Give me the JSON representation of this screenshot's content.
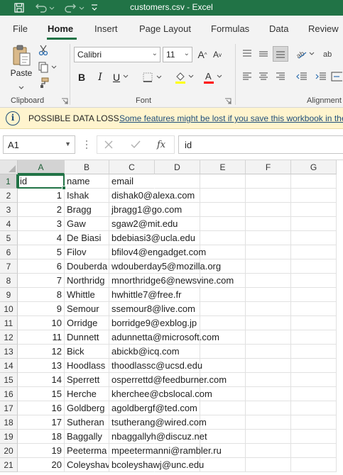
{
  "window": {
    "title": "customers.csv  -  Excel",
    "brand_color": "#217346",
    "quick_access": [
      "save-icon",
      "undo-icon",
      "redo-icon",
      "customize-icon"
    ]
  },
  "ribbon": {
    "tabs": [
      "File",
      "Home",
      "Insert",
      "Page Layout",
      "Formulas",
      "Data",
      "Review"
    ],
    "active_tab": "Home",
    "clipboard": {
      "paste_label": "Paste",
      "group_label": "Clipboard"
    },
    "font": {
      "family": "Calibri",
      "size": "11",
      "bold": "B",
      "italic": "I",
      "underline": "U",
      "group_label": "Font",
      "fill_color": "#ffff00",
      "font_color": "#ff0000"
    },
    "alignment": {
      "group_label": "Alignment"
    }
  },
  "message_bar": {
    "title": "POSSIBLE DATA LOSS",
    "text": "Some features might be lost if you save this workbook in the"
  },
  "formula_bar": {
    "name_box": "A1",
    "fx_label": "fx",
    "formula": "id"
  },
  "sheet": {
    "columns": [
      "A",
      "B",
      "C",
      "D",
      "E",
      "F",
      "G"
    ],
    "selected_column": "A",
    "selected_row": 1,
    "row_numbers": [
      1,
      2,
      3,
      4,
      5,
      6,
      7,
      8,
      9,
      10,
      11,
      12,
      13,
      14,
      15,
      16,
      17,
      18,
      19,
      20,
      21
    ],
    "headers": [
      "id",
      "name",
      "email"
    ],
    "rows": [
      [
        "1",
        "Ishak",
        "dishak0@alexa.com"
      ],
      [
        "2",
        "Bragg",
        "jbragg1@go.com"
      ],
      [
        "3",
        "Gaw",
        "sgaw2@mit.edu"
      ],
      [
        "4",
        "De Biasi",
        "bdebiasi3@ucla.edu"
      ],
      [
        "5",
        "Filov",
        "bfilov4@engadget.com"
      ],
      [
        "6",
        "Douberda",
        "wdouberday5@mozilla.org"
      ],
      [
        "7",
        "Northridg",
        "mnorthridge6@newsvine.com"
      ],
      [
        "8",
        "Whittle",
        "hwhittle7@free.fr"
      ],
      [
        "9",
        "Semour",
        "ssemour8@live.com"
      ],
      [
        "10",
        "Orridge",
        "borridge9@exblog.jp"
      ],
      [
        "11",
        "Dunnett",
        "adunnetta@microsoft.com"
      ],
      [
        "12",
        "Bick",
        "abickb@icq.com"
      ],
      [
        "13",
        "Hoodlass",
        "thoodlassc@ucsd.edu"
      ],
      [
        "14",
        "Sperrett",
        "osperrettd@feedburner.com"
      ],
      [
        "15",
        "Herche",
        "kherchee@cbslocal.com"
      ],
      [
        "16",
        "Goldberg",
        "agoldbergf@ted.com"
      ],
      [
        "17",
        "Sutheran",
        "tsutherang@wired.com"
      ],
      [
        "18",
        "Baggally",
        "nbaggallyh@discuz.net"
      ],
      [
        "19",
        "Peeterma",
        "mpeetermanni@rambler.ru"
      ],
      [
        "20",
        "Coleyshav",
        "bcoleyshawj@unc.edu"
      ]
    ]
  }
}
